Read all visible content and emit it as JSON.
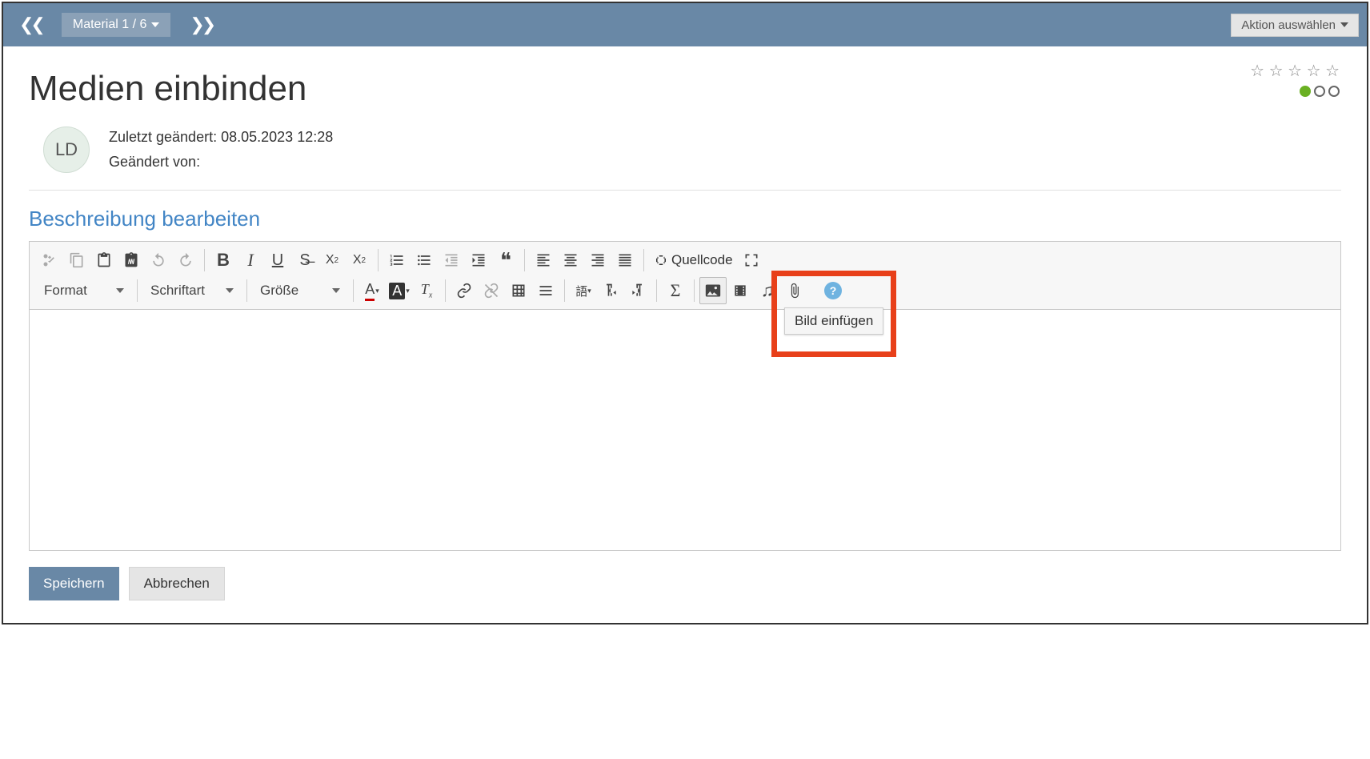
{
  "topbar": {
    "material_label": "Material 1 / 6",
    "action_label": "Aktion auswählen"
  },
  "page": {
    "title": "Medien einbinden",
    "last_changed_prefix": "Zuletzt geändert:",
    "last_changed_value": "08.05.2023 12:28",
    "changed_by_label": "Geändert von:",
    "changed_by_value": "",
    "avatar_initials": "LD",
    "section_heading": "Beschreibung bearbeiten"
  },
  "editor": {
    "source_label": "Quellcode",
    "format_label": "Format",
    "font_label": "Schriftart",
    "size_label": "Größe",
    "tooltip_image": "Bild einfügen"
  },
  "buttons": {
    "save": "Speichern",
    "cancel": "Abbrechen"
  }
}
